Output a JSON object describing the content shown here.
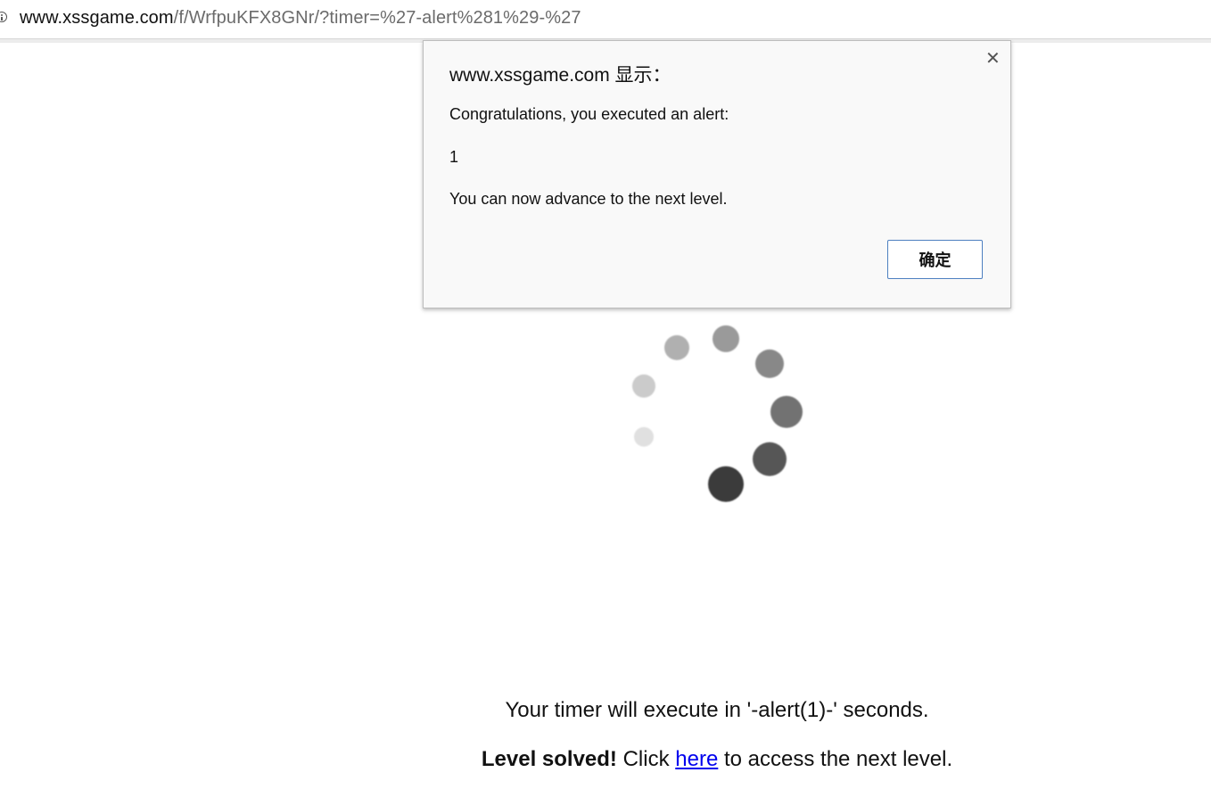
{
  "browser": {
    "url_host": "www.xssgame.com",
    "url_path": "/f/WrfpuKFX8GNr/?timer=%27-alert%281%29-%27",
    "info_icon": "info-circle-icon"
  },
  "page": {
    "timer_message": "Your timer will execute in '-alert(1)-' seconds.",
    "solved_bold": "Level solved!",
    "solved_pre": " Click ",
    "solved_link": "here",
    "solved_post": " to access the next level."
  },
  "dialog": {
    "title": "www.xssgame.com 显示：",
    "close_icon": "close-icon",
    "line1": "Congratulations, you executed an alert:",
    "line2": "1",
    "line3": "You can now advance to the next level.",
    "ok_label": "确定"
  },
  "spinner": {
    "icon": "loading-spinner-icon"
  }
}
